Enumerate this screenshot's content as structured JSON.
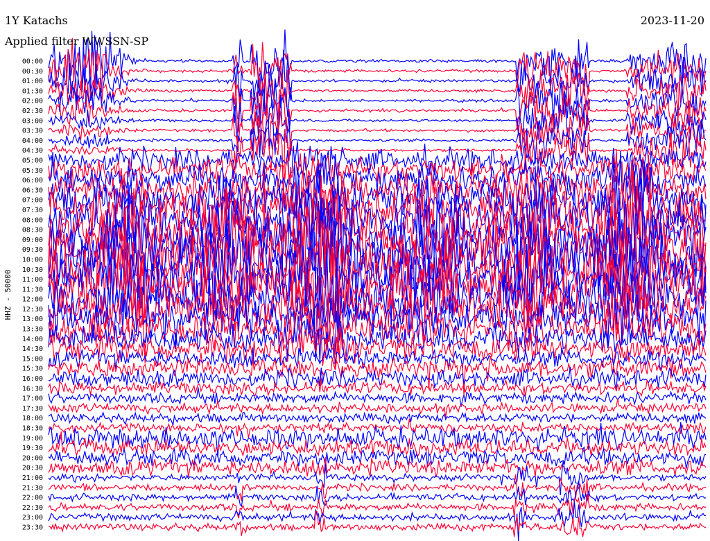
{
  "header": {
    "station": "1Y Katachs",
    "date": "2023-11-20",
    "filter": "Applied filter WWSSN-SP"
  },
  "chart_data": {
    "type": "line",
    "title": "1Y Katachs",
    "ylabel": "HHZ - 50000",
    "tick_labels": [
      "00:00",
      "00:30",
      "01:00",
      "01:30",
      "02:00",
      "02:30",
      "03:00",
      "03:30",
      "04:00",
      "04:30",
      "05:00",
      "05:30",
      "06:00",
      "06:30",
      "07:00",
      "07:30",
      "08:00",
      "08:30",
      "09:00",
      "09:30",
      "10:00",
      "10:30",
      "11:00",
      "11:30",
      "12:00",
      "12:30",
      "13:00",
      "13:30",
      "14:00",
      "14:30",
      "15:00",
      "15:30",
      "16:00",
      "16:30",
      "17:00",
      "17:30",
      "18:00",
      "18:30",
      "19:00",
      "19:30",
      "20:00",
      "20:30",
      "21:00",
      "21:30",
      "22:00",
      "22:30",
      "23:00",
      "23:30"
    ],
    "series_colors": [
      "#0000ff",
      "#ff0033"
    ],
    "grid": false
  }
}
